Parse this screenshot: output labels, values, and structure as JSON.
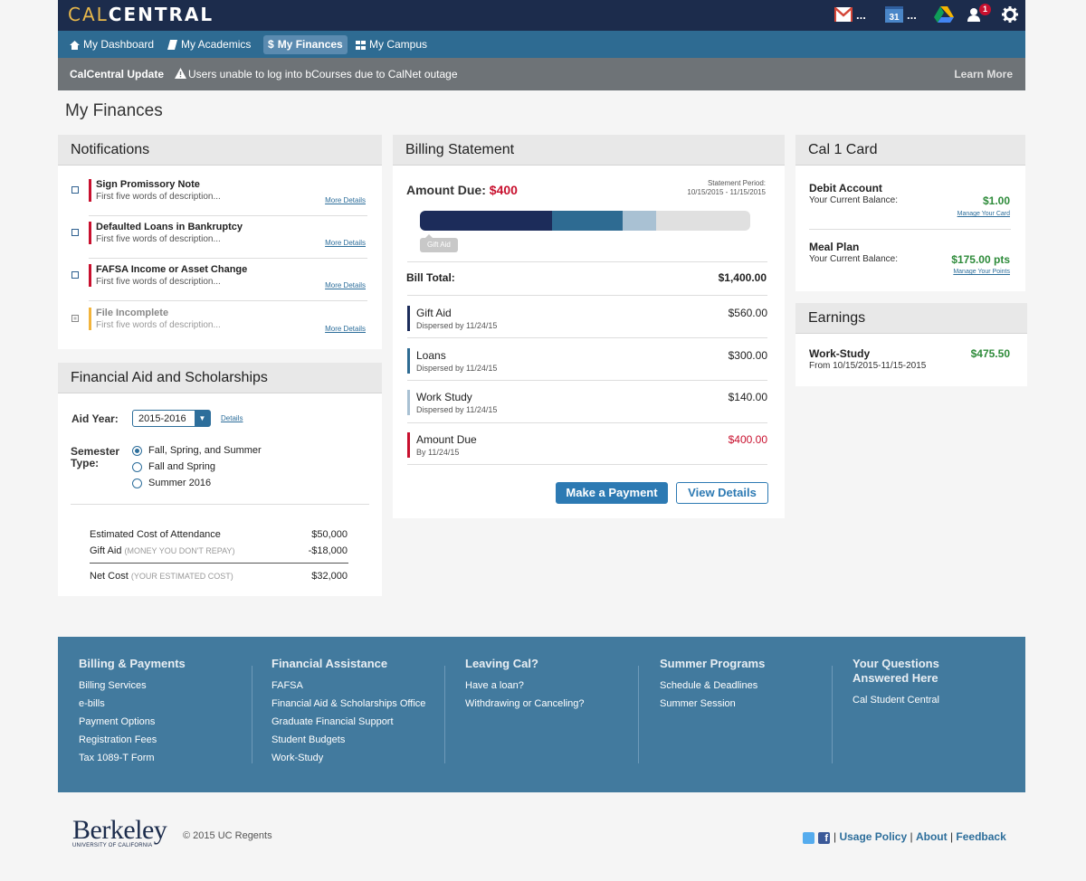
{
  "app": {
    "logo_cal": "CAL",
    "logo_central": "CENTRAL"
  },
  "header_icons": {
    "mail_dots": "...",
    "calendar_day": "31",
    "calendar_dots": "...",
    "notifications_count": "1"
  },
  "nav": {
    "items": [
      {
        "label": "My Dashboard",
        "icon": "home-icon"
      },
      {
        "label": "My Academics",
        "icon": "book-icon"
      },
      {
        "label": "My Finances",
        "icon": "dollar-icon",
        "active": true
      },
      {
        "label": "My Campus",
        "icon": "grid-icon"
      }
    ]
  },
  "alert": {
    "title": "CalCentral Update",
    "message": "Users unable to log into bCourses due to CalNet outage",
    "link": "Learn More"
  },
  "page_title": "My Finances",
  "notifications": {
    "title": "Notifications",
    "items": [
      {
        "title": "Sign Promissory Note",
        "desc": "First five words of description...",
        "link": "More Details",
        "color": "#c8102e"
      },
      {
        "title": "Defaulted Loans in Bankruptcy",
        "desc": "First five words of description...",
        "link": "More Details",
        "color": "#c8102e"
      },
      {
        "title": "FAFSA Income or Asset Change",
        "desc": "First five words of description...",
        "link": "More Details",
        "color": "#c8102e"
      },
      {
        "title": "File Incomplete",
        "desc": "First five words of description...",
        "link": "More Details",
        "color": "#f2b43c"
      }
    ]
  },
  "aid": {
    "title": "Financial Aid and Scholarships",
    "year_label": "Aid Year:",
    "year_value": "2015-2016",
    "details_link": "Details",
    "semester_label": "Semester Type:",
    "options": [
      "Fall, Spring, and Summer",
      "Fall and Spring",
      "Summer 2016"
    ],
    "selected_option": "Fall, Spring, and Summer",
    "cost_label": "Estimated Cost of Attendance",
    "cost_value": "$50,000",
    "gift_label": "Gift Aid",
    "gift_note": "(MONEY YOU DON'T REPAY)",
    "gift_value": "-$18,000",
    "net_label": "Net Cost",
    "net_note": "(YOUR ESTIMATED COST)",
    "net_value": "$32,000"
  },
  "billing": {
    "title": "Billing Statement",
    "amount_due_label": "Amount Due:",
    "amount_due_value": "$400",
    "period_label": "Statement Period:",
    "period_value": "10/15/2015 - 11/15/2015",
    "progress_segments": [
      {
        "label": "Gift Aid",
        "value": 560,
        "color": "#1c2c5a"
      },
      {
        "label": "Loans",
        "value": 300,
        "color": "#2e6b92"
      },
      {
        "label": "Work Study",
        "value": 140,
        "color": "#a9c1d3"
      }
    ],
    "progress_total": 1400,
    "tooltip": "Gift Aid",
    "bill_total_label": "Bill Total:",
    "bill_total_value": "$1,400.00",
    "rows": [
      {
        "name": "Gift Aid",
        "sub": "Dispersed by 11/24/15",
        "value": "$560.00",
        "color": "#1c2c5a",
        "value_color": "#222"
      },
      {
        "name": "Loans",
        "sub": "Dispersed by 11/24/15",
        "value": "$300.00",
        "color": "#2e6b92",
        "value_color": "#222"
      },
      {
        "name": "Work Study",
        "sub": "Dispersed by 11/24/15",
        "value": "$140.00",
        "color": "#a9c1d3",
        "value_color": "#222"
      },
      {
        "name": "Amount Due",
        "sub": "By 11/24/15",
        "value": "$400.00",
        "color": "#c8102e",
        "value_color": "#c8102e"
      }
    ],
    "pay_button": "Make a Payment",
    "view_button": "View Details"
  },
  "cal1": {
    "title": "Cal 1 Card",
    "debit_title": "Debit Account",
    "debit_label": "Your Current Balance:",
    "debit_value": "$1.00",
    "debit_link": "Manage Your Card",
    "meal_title": "Meal Plan",
    "meal_label": "Your Current Balance:",
    "meal_value": "$175.00 pts",
    "meal_link": "Manage Your Points"
  },
  "earnings": {
    "title": "Earnings",
    "name": "Work-Study",
    "range": "From 10/15/2015-11/15-2015",
    "value": "$475.50"
  },
  "footer": {
    "columns": [
      {
        "title": "Billing & Payments",
        "links": [
          "Billing Services",
          "e-bills",
          "Payment Options",
          "Registration Fees",
          "Tax 1089-T Form"
        ]
      },
      {
        "title": "Financial Assistance",
        "links": [
          "FAFSA",
          "Financial Aid & Scholarships Office",
          "Graduate Financial Support",
          "Student Budgets",
          "Work-Study"
        ]
      },
      {
        "title": "Leaving Cal?",
        "links": [
          "Have a loan?",
          "Withdrawing or Canceling?"
        ]
      },
      {
        "title": "Summer Programs",
        "links": [
          "Schedule & Deadlines",
          "Summer Session"
        ]
      },
      {
        "title": "Your Questions Answered Here",
        "links": [
          "Cal Student Central"
        ]
      }
    ]
  },
  "bottom": {
    "berkeley": "Berkeley",
    "berkeley_sub": "UNIVERSITY OF CALIFORNIA",
    "copyright": "© 2015 UC Regents",
    "links": [
      "Usage Policy",
      "About",
      "Feedback"
    ]
  },
  "colors": {
    "brand": "#1c2c4c",
    "nav": "#2e6b92",
    "accent_red": "#c8102e",
    "green": "#2e8b3a",
    "footer": "#427a9e"
  }
}
